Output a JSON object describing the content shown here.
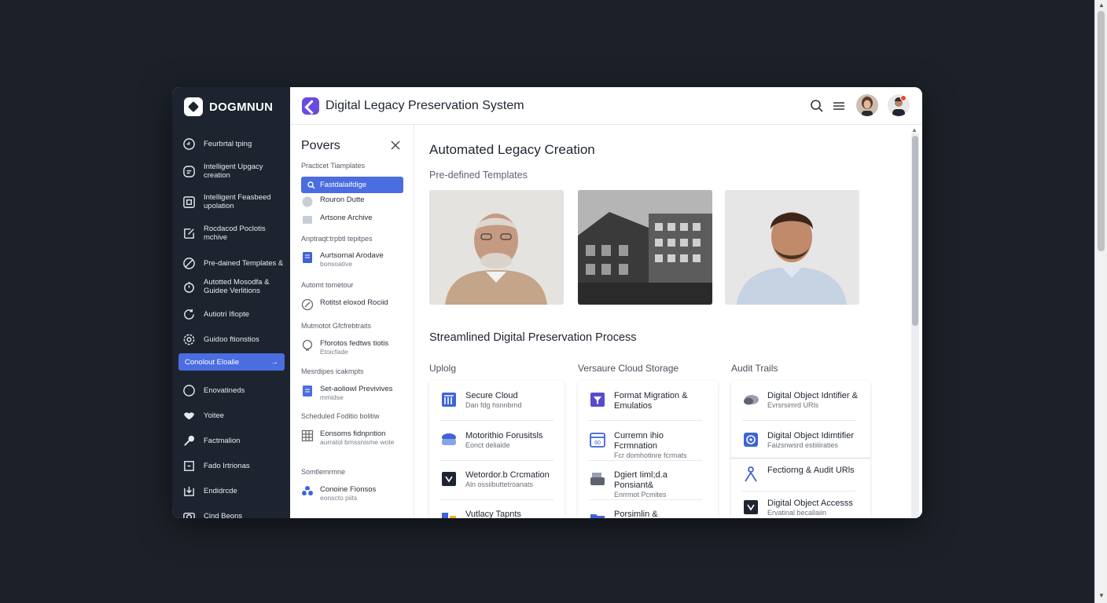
{
  "brand": {
    "name": "DOGMNUN"
  },
  "header": {
    "title": "Digital Legacy Preservation System"
  },
  "sidebar": {
    "items": [
      {
        "label": "Feurbrtal tping",
        "icon": "clock-icon"
      },
      {
        "label": "Intelligent Upgacy creation",
        "icon": "chat-icon"
      },
      {
        "label": "Intelligent Feasbeed upolation",
        "icon": "document-icon"
      },
      {
        "label": "Rocdacod Poclotis mchive",
        "icon": "edit-icon"
      },
      {
        "label": "Pre-dained Templates &",
        "icon": "link-icon"
      },
      {
        "label": "Autotted Mosodfa & Guidee Verlitions",
        "icon": "timer-icon"
      },
      {
        "label": "Autiotri Ifiopte",
        "icon": "refresh-icon"
      },
      {
        "label": "Guidoo ftionstios",
        "icon": "settings-icon"
      }
    ],
    "active": {
      "label": "Conolout Eloalie",
      "icon": "arrow-right-icon"
    },
    "bottom_items": [
      {
        "label": "Enovatineds",
        "icon": "circle-icon"
      },
      {
        "label": "Yoitee",
        "icon": "handshake-icon"
      },
      {
        "label": "Factmalion",
        "icon": "tool-icon"
      },
      {
        "label": "Fado Irtrionas",
        "icon": "frame-icon"
      },
      {
        "label": "Endidrcde",
        "icon": "import-icon"
      },
      {
        "label": "Cind Beons",
        "icon": "camera-icon"
      }
    ]
  },
  "panel": {
    "title": "Povers",
    "sections": [
      "Practicet Tiamplates",
      "Anptraqt:trpbtl tepitpes",
      "Automt tometour",
      "Mutmotot Gfcfrebtraits",
      "Mesrdipes icakmpts",
      "Scheduled Foditio bolitiw",
      "Somtlemrmne"
    ],
    "active": {
      "label": "Fastdalaifdige"
    },
    "items": [
      {
        "title": "Rouron Dutte",
        "sub": ""
      },
      {
        "title": "Artsone Archive",
        "sub": ""
      },
      {
        "title": "Aurtsornal Arodave",
        "sub": "bonsoative"
      },
      {
        "title": "Rotitst eloxod Rociid",
        "sub": ""
      },
      {
        "title": "Fforotos fedtws tiotis",
        "sub": "Etoicfade"
      },
      {
        "title": "Set-aoliowl Previvives",
        "sub": "mmidse"
      },
      {
        "title": "Eonsoms fidnpntion",
        "sub": "aurratol bmssnisme wote"
      },
      {
        "title": "Conoine Fionsos",
        "sub": "eonscto piits"
      }
    ]
  },
  "main": {
    "title": "Automated Legacy Creation",
    "templates_label": "Pre-defined Templates",
    "process_title": "Streamlined Digital Preservation Process",
    "columns": [
      {
        "heading": "Uplolg",
        "rows": [
          {
            "title": "Secure Cloud",
            "sub": "Dan fdg hsnnbrnd",
            "icon": "building-icon"
          },
          {
            "title": "Motorithio Forusitsls",
            "sub": "Eonct deliaide",
            "icon": "cloud-icon"
          },
          {
            "title": "Wetordor.b Crcmation",
            "sub": "Aln ossiibuttetroanats",
            "icon": "award-icon"
          },
          {
            "title": "Vutlacy Tapnts",
            "sub": "",
            "icon": "chart-icon"
          }
        ]
      },
      {
        "heading": "Versaure Cloud Storage",
        "rows": [
          {
            "title": "Format Migration & Emulatios",
            "sub": "",
            "icon": "filter-icon"
          },
          {
            "title": "Curremn ihio Fcrmnation",
            "sub": "Fcr domhotinre fcrmats",
            "icon": "calendar-icon"
          },
          {
            "title": "Dgiert Iiml;d.a Ponsiant&",
            "sub": "Enrrmot Pcmites",
            "icon": "printer-icon"
          },
          {
            "title": "Porsimlin & Mflansitiom",
            "sub": "",
            "icon": "folder-icon"
          }
        ]
      },
      {
        "heading": "Audit Trails",
        "rows": [
          {
            "title": "Digital Object Idntifier &",
            "sub": "Evrsrsimrd URls",
            "icon": "cloud-storage-icon"
          },
          {
            "title": "Digital Object Idimtifier",
            "sub": "Faizsnwsrd estiiiiraties",
            "icon": "target-icon"
          },
          {
            "title": "Fectiorng & Audit URls",
            "sub": "",
            "icon": "user-icon"
          },
          {
            "title": "Digital Object Accesss",
            "sub": "Ervatinal becallaiin",
            "icon": "award-icon"
          }
        ]
      }
    ]
  },
  "colors": {
    "accent": "#4a6de0",
    "sidebar_bg": "#1d2430",
    "brand_purple": "#6a4ae0",
    "page_bg": "#1c2129"
  }
}
